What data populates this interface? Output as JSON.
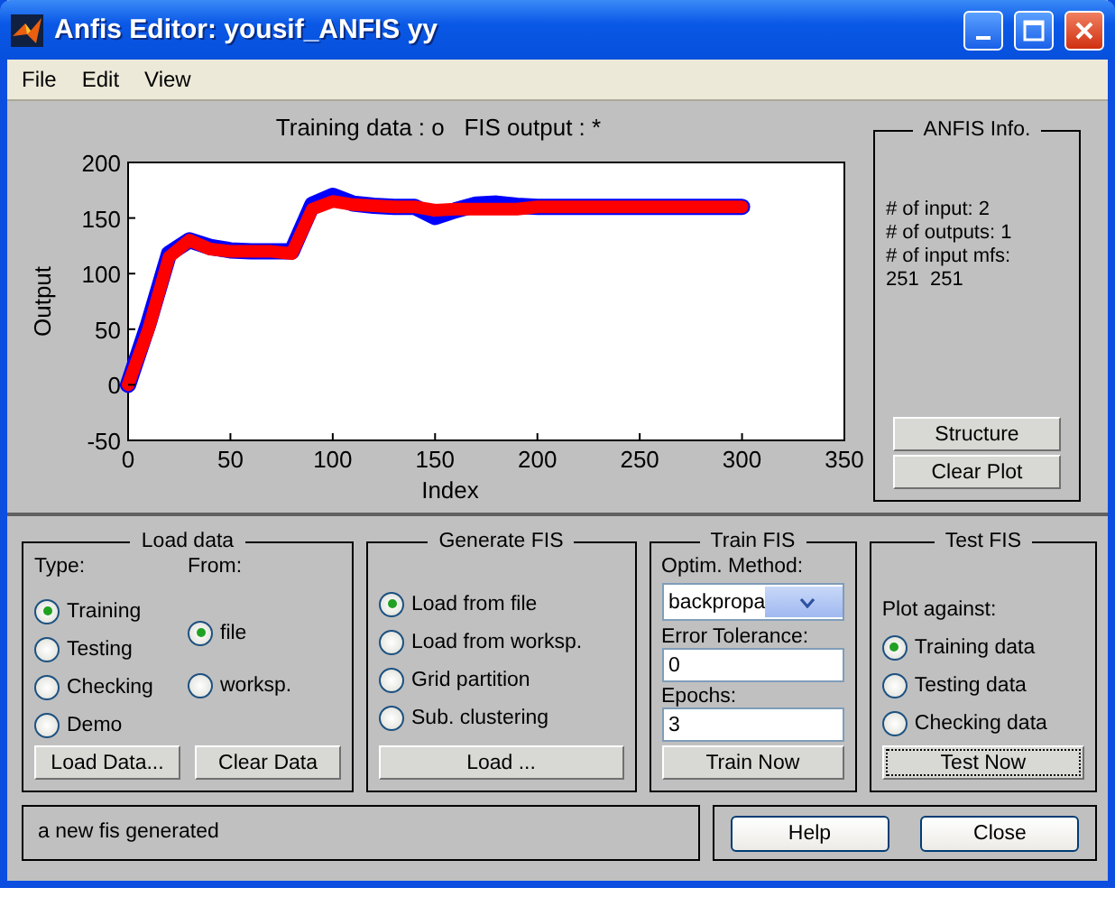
{
  "window": {
    "title": "Anfis Editor: yousif_ANFIS yy"
  },
  "menu": [
    "File",
    "Edit",
    "View"
  ],
  "plot": {
    "title": "Training data : o   FIS output : *",
    "chart_data": {
      "type": "line",
      "xlabel": "Index",
      "ylabel": "Output",
      "x": [
        0,
        10,
        20,
        30,
        40,
        50,
        60,
        70,
        80,
        90,
        100,
        110,
        120,
        130,
        140,
        150,
        160,
        170,
        180,
        190,
        200,
        210,
        220,
        230,
        240,
        250,
        260,
        270,
        280,
        290,
        300
      ],
      "xlim": [
        0,
        350
      ],
      "ylim": [
        -50,
        200
      ],
      "xticks": [
        0,
        50,
        100,
        150,
        200,
        250,
        300,
        350
      ],
      "yticks": [
        -50,
        0,
        50,
        100,
        150,
        200
      ],
      "series": [
        {
          "color": "#0000ff",
          "values": [
            0,
            55,
            118,
            130,
            124,
            121,
            120,
            120,
            120,
            162,
            170,
            163,
            161,
            160,
            160,
            151,
            157,
            162,
            163,
            161,
            160,
            160,
            160,
            160,
            160,
            160,
            160,
            160,
            160,
            160,
            160
          ]
        },
        {
          "color": "#ff0000",
          "values": [
            0,
            50,
            115,
            130,
            122,
            120,
            120,
            120,
            118,
            158,
            165,
            162,
            161,
            160,
            160,
            157,
            158,
            158,
            158,
            158,
            160,
            160,
            160,
            160,
            160,
            160,
            160,
            160,
            160,
            160,
            160
          ]
        }
      ]
    }
  },
  "anfis_info": {
    "title": "ANFIS Info.",
    "lines": [
      "# of input: 2",
      "# of outputs: 1",
      "# of input mfs:",
      "251  251"
    ],
    "buttons": [
      "Structure",
      "Clear Plot"
    ]
  },
  "load_data": {
    "title": "Load data",
    "type_label": "Type:",
    "from_label": "From:",
    "types": [
      {
        "label": "Training",
        "selected": true
      },
      {
        "label": "Testing",
        "selected": false
      },
      {
        "label": "Checking",
        "selected": false
      },
      {
        "label": "Demo",
        "selected": false
      }
    ],
    "sources": [
      {
        "label": "file",
        "selected": true
      },
      {
        "label": "worksp.",
        "selected": false
      }
    ],
    "buttons": [
      "Load Data...",
      "Clear Data"
    ]
  },
  "generate_fis": {
    "title": "Generate FIS",
    "options": [
      {
        "label": "Load from file",
        "selected": true
      },
      {
        "label": "Load from worksp.",
        "selected": false
      },
      {
        "label": "Grid partition",
        "selected": false
      },
      {
        "label": "Sub. clustering",
        "selected": false
      }
    ],
    "button": "Load ..."
  },
  "train_fis": {
    "title": "Train FIS",
    "method_label": "Optim. Method:",
    "method": "backpropa",
    "error_label": "Error Tolerance:",
    "error": "0",
    "epochs_label": "Epochs:",
    "epochs": "3",
    "button": "Train Now"
  },
  "test_fis": {
    "title": "Test FIS",
    "plot_label": "Plot against:",
    "options": [
      {
        "label": "Training data",
        "selected": true
      },
      {
        "label": "Testing data",
        "selected": false
      },
      {
        "label": "Checking data",
        "selected": false
      }
    ],
    "button": "Test Now"
  },
  "status": "a new fis generated",
  "buttons": [
    "Help",
    "Close"
  ]
}
